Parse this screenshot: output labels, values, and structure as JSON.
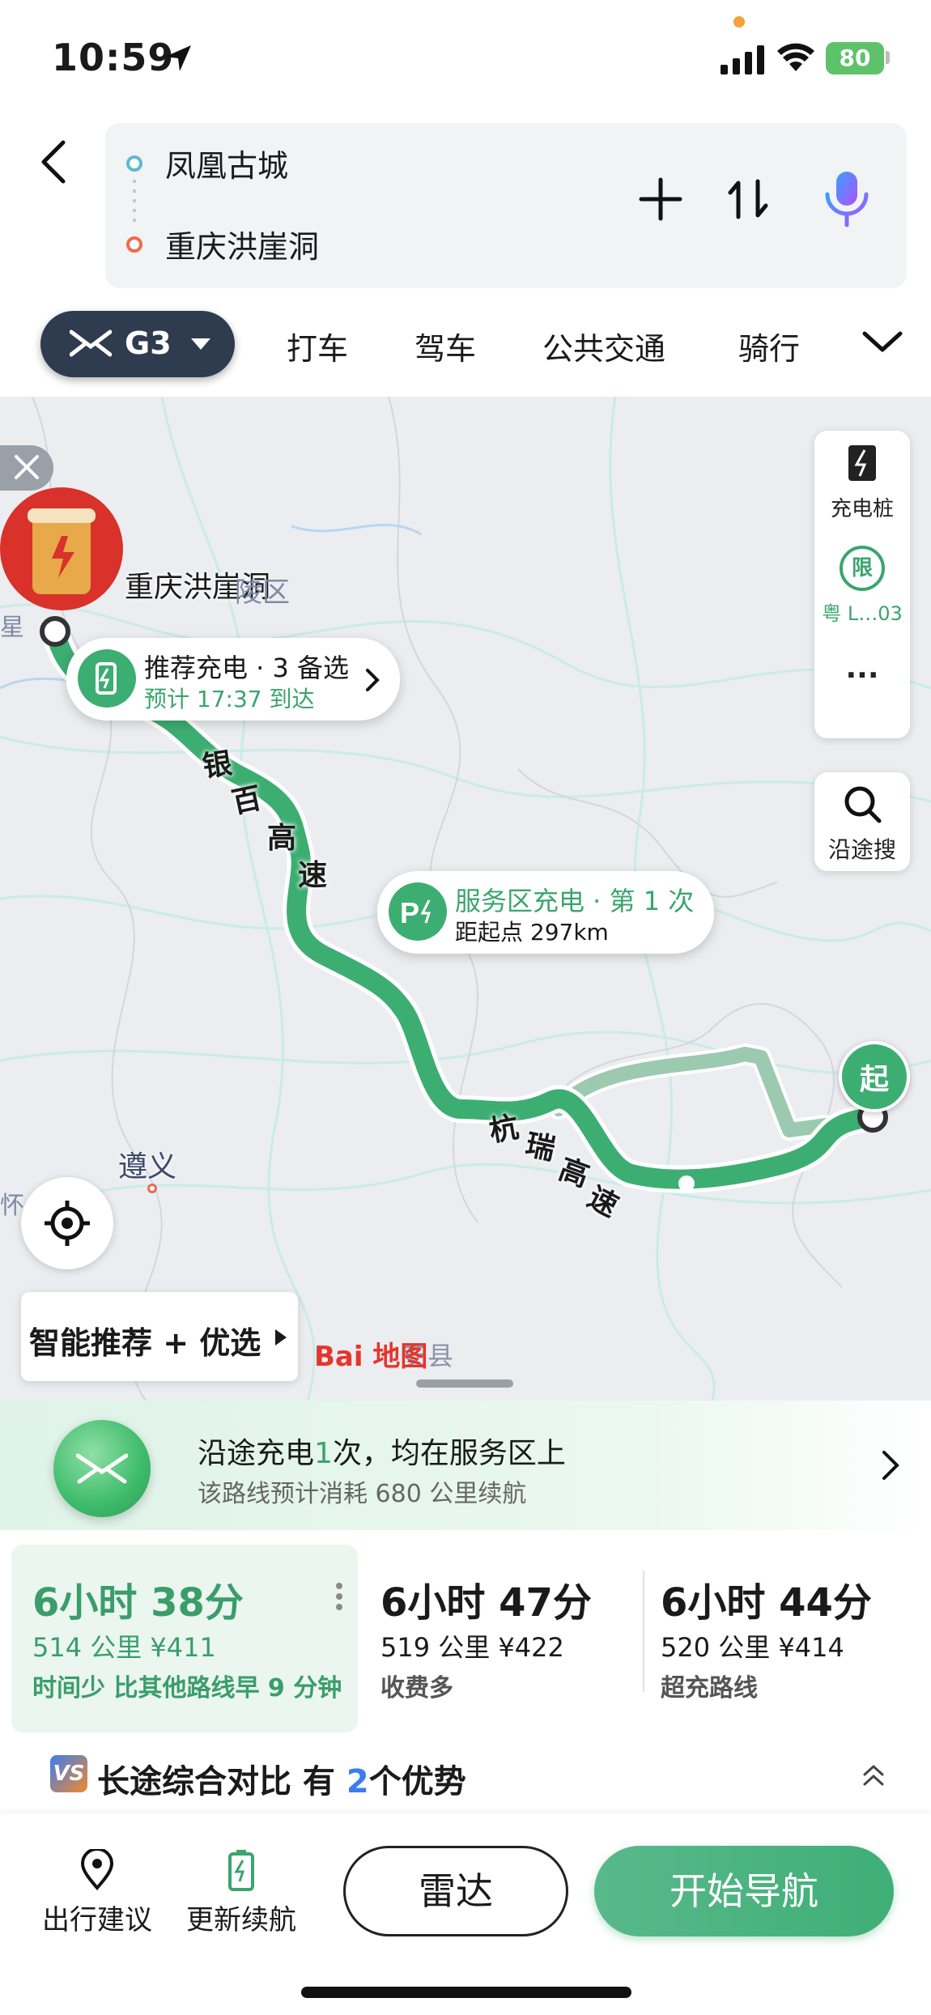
{
  "status": {
    "time": "10:59",
    "battery": "80"
  },
  "route": {
    "origin": "凤凰古城",
    "destination": "重庆洪崖洞"
  },
  "header_icons": [
    "back-arrow-icon",
    "add-stop-icon",
    "swap-route-icon",
    "microphone-icon"
  ],
  "modes": {
    "vehicle": "G3",
    "tabs": [
      "打车",
      "驾车",
      "公共交通",
      "骑行"
    ]
  },
  "map": {
    "destination_label": "重庆洪崖洞",
    "district_label": "陵区",
    "city_label": "遵义",
    "left_edge_label": "怀",
    "left_edge_label_top": "星",
    "county_label": "安县",
    "road_1": [
      "银",
      "百",
      "高",
      "速"
    ],
    "road_2": [
      "杭",
      "瑞",
      "高",
      "速"
    ],
    "recommend": {
      "title": "推荐充电 · 3 备选",
      "subtitle": "预计 17:37 到达"
    },
    "service": {
      "title": "服务区充电 · 第 1 次",
      "subtitle": "距起点 297km"
    },
    "start_marker": "起",
    "side_panel": {
      "charging": "充电桩",
      "limit": "粤 L…03",
      "limit_badge": "限",
      "more": "···"
    },
    "search_along": "沿途搜",
    "smart_button": "智能推荐 + 优选",
    "baidu_logo": "Bai 地图",
    "colors": {
      "route": "#3dae72",
      "route_alt": "#8fc5a7"
    }
  },
  "charging_banner": {
    "line_prefix": "沿途充电",
    "count": "1",
    "line_suffix": "次，均在服务区上",
    "note": "该路线预计消耗 680 公里续航"
  },
  "routes": [
    {
      "duration": "6小时 38分",
      "distance": "514 公里  ¥411",
      "tag": "时间少 比其他路线早 9 分钟"
    },
    {
      "duration": "6小时 47分",
      "distance": "519 公里  ¥422",
      "tag": "收费多"
    },
    {
      "duration": "6小时 44分",
      "distance": "520 公里  ¥414",
      "tag": "超充路线"
    }
  ],
  "compare": {
    "badge": "VS",
    "prefix": "长途综合对比 有 ",
    "count": "2",
    "suffix": "个优势"
  },
  "bottom": {
    "advice": "出行建议",
    "update_range": "更新续航",
    "radar": "雷达",
    "start_nav": "开始导航"
  }
}
